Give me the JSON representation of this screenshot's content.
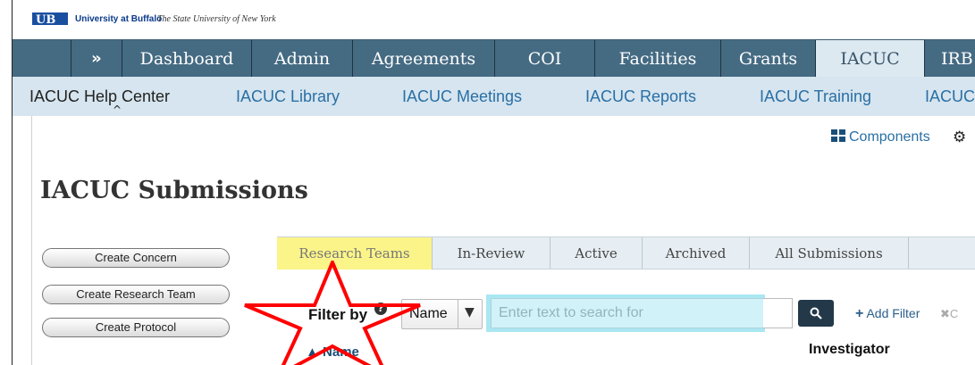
{
  "header": {
    "institution": "University at Buffalo",
    "tagline": "The State University of New York"
  },
  "primary_nav": {
    "expand_label": "»",
    "items": [
      {
        "label": "Dashboard"
      },
      {
        "label": "Admin"
      },
      {
        "label": "Agreements"
      },
      {
        "label": "COI"
      },
      {
        "label": "Facilities"
      },
      {
        "label": "Grants"
      },
      {
        "label": "IACUC",
        "active": true
      },
      {
        "label": "IRB"
      }
    ]
  },
  "secondary_nav": {
    "items": [
      {
        "label": "IACUC Help Center",
        "current": true
      },
      {
        "label": "IACUC Library"
      },
      {
        "label": "IACUC Meetings"
      },
      {
        "label": "IACUC Reports"
      },
      {
        "label": "IACUC Training"
      },
      {
        "label": "IACUC"
      }
    ],
    "caret": "^"
  },
  "toolbar": {
    "components_label": "Components",
    "settings_icon": "gear-icon"
  },
  "page": {
    "title": "IACUC Submissions"
  },
  "actions": [
    {
      "label": "Create Concern"
    },
    {
      "label": "Create Research Team"
    },
    {
      "label": "Create Protocol"
    }
  ],
  "tabs": [
    {
      "label": "Research Teams",
      "active": true
    },
    {
      "label": "In-Review"
    },
    {
      "label": "Active"
    },
    {
      "label": "Archived"
    },
    {
      "label": "All Submissions"
    }
  ],
  "filter": {
    "label": "Filter by",
    "help": "?",
    "field_value": "Name",
    "search_placeholder": "Enter text to search for",
    "search_value": "",
    "add_filter_label": "Add Filter",
    "clear_label": "C"
  },
  "table": {
    "columns": [
      {
        "label": "Name"
      },
      {
        "label": "Investigator"
      }
    ]
  },
  "annotations": {
    "highlight_color": "#fbf489",
    "search_highlight_color": "#a9e7f2",
    "star_color": "#ff0000"
  }
}
